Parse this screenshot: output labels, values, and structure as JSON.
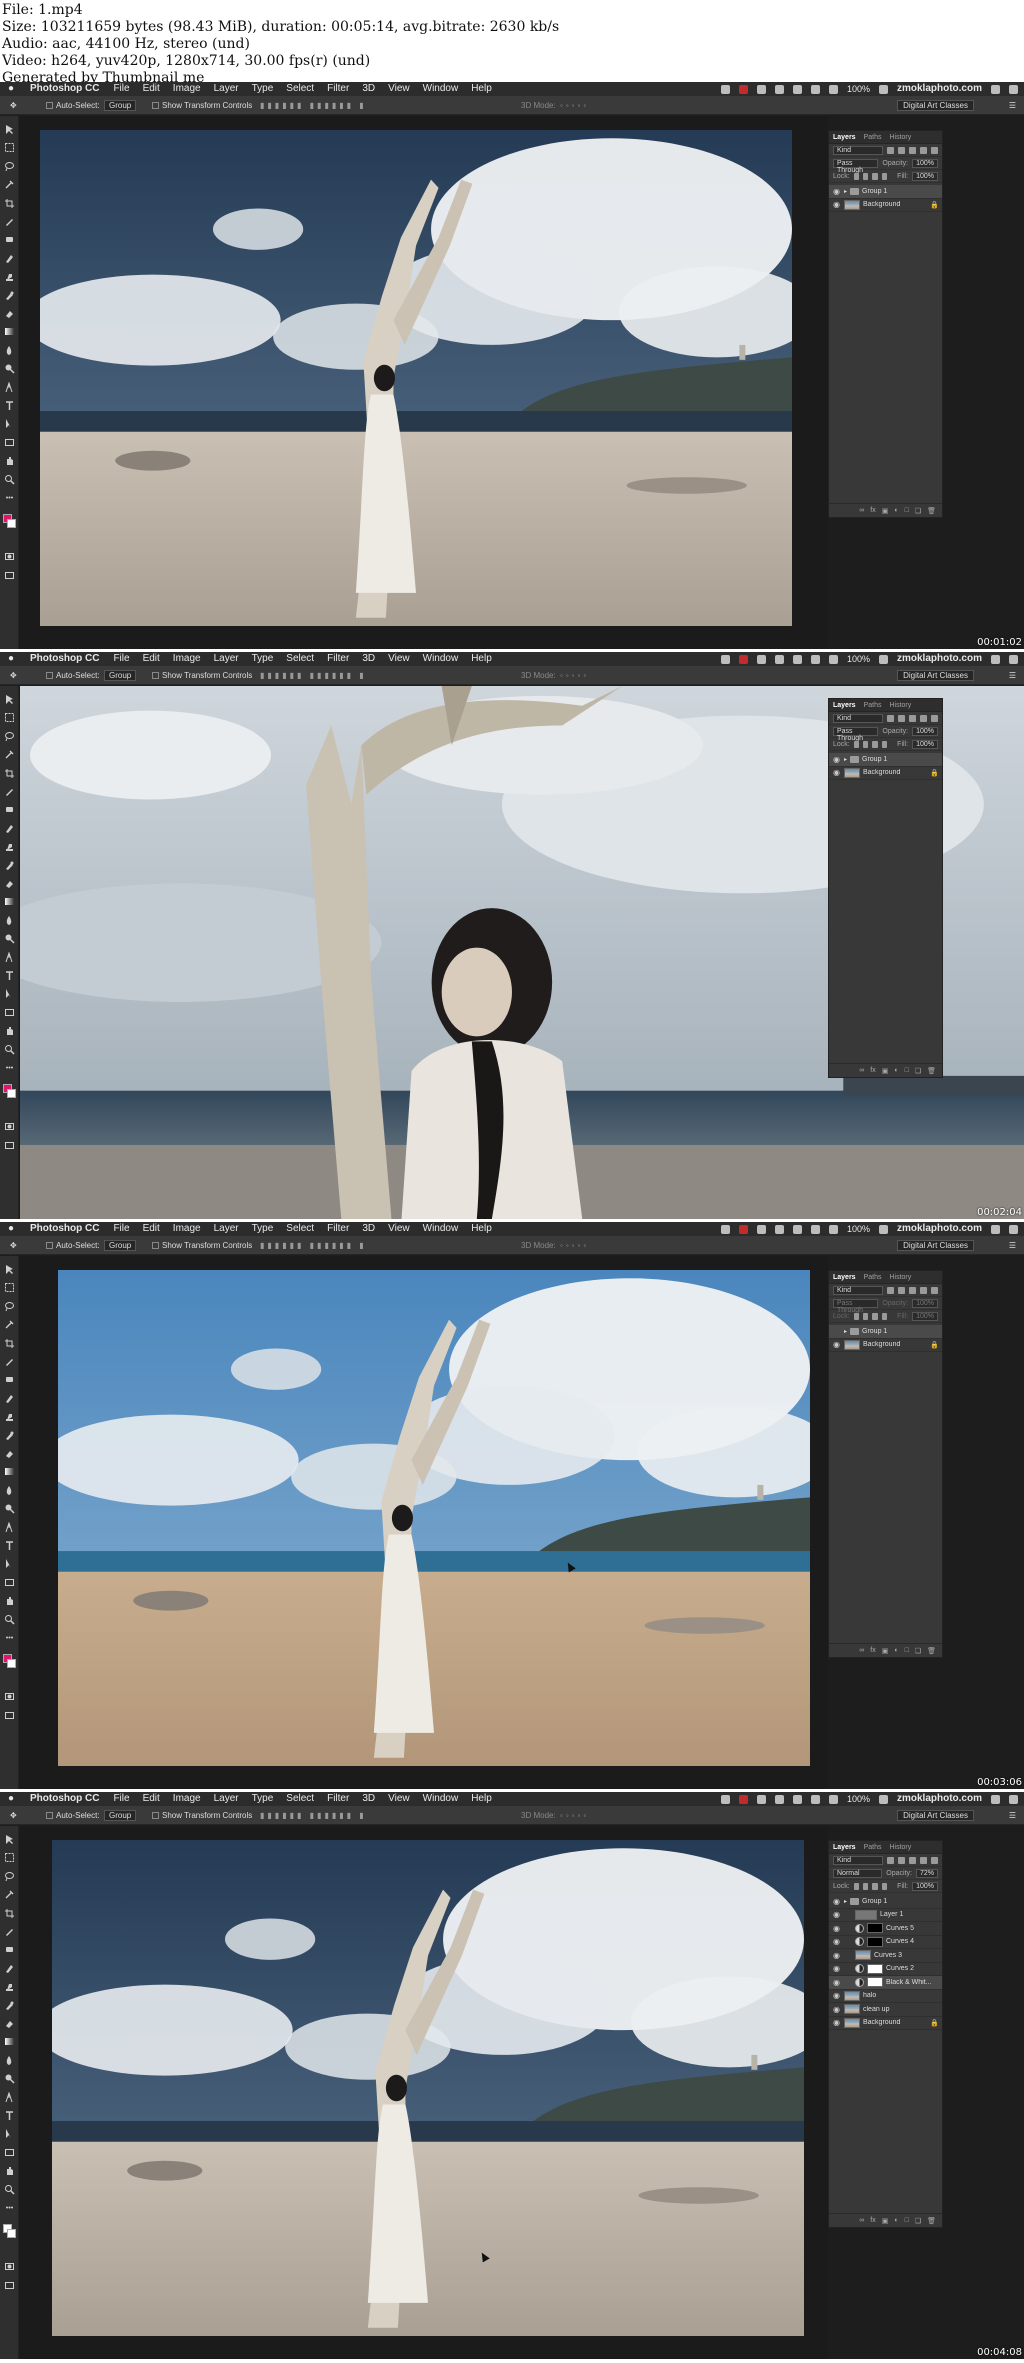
{
  "header": {
    "lines": [
      "File: 1.mp4",
      "Size: 103211659 bytes (98.43 MiB), duration: 00:05:14, avg.bitrate: 2630 kb/s",
      "Audio: aac, 44100 Hz, stereo (und)",
      "Video: h264, yuv420p, 1280x714, 30.00 fps(r) (und)",
      "Generated by Thumbnail me"
    ]
  },
  "menubar": {
    "app_name": "Photoshop CC",
    "items": [
      "File",
      "Edit",
      "Image",
      "Layer",
      "Type",
      "Select",
      "Filter",
      "3D",
      "View",
      "Window",
      "Help"
    ],
    "battery": "100%",
    "site": "zmoklaphoto.com"
  },
  "optionsbar": {
    "auto_select_label": "Auto-Select:",
    "auto_select_value": "Group",
    "transform_label": "Show Transform Controls",
    "mode_3d": "3D Mode:",
    "workspace": "Digital Art Classes"
  },
  "panel": {
    "tabs": [
      "Layers",
      "Paths",
      "History"
    ],
    "kind_label": "Kind",
    "lock_label": "Lock:",
    "fill_label": "Fill:",
    "opacity_label": "Opacity:"
  },
  "frames": [
    {
      "timestamp": "00:01:02",
      "blend": "Pass Through",
      "opacity": "100%",
      "fill": "100%",
      "dimmed": false,
      "layers": [
        {
          "name": "Group 1",
          "type": "folder",
          "visible": true,
          "selected": true,
          "indent": 0
        },
        {
          "name": "Background",
          "type": "img",
          "visible": true,
          "selected": false,
          "indent": 0,
          "locked": true
        }
      ]
    },
    {
      "timestamp": "00:02:04",
      "blend": "Pass Through",
      "opacity": "100%",
      "fill": "100%",
      "dimmed": false,
      "layers": [
        {
          "name": "Group 1",
          "type": "folder",
          "visible": true,
          "selected": true,
          "indent": 0
        },
        {
          "name": "Background",
          "type": "img",
          "visible": true,
          "selected": false,
          "indent": 0,
          "locked": true
        }
      ]
    },
    {
      "timestamp": "00:03:06",
      "blend": "Pass Through",
      "opacity": "100%",
      "fill": "100%",
      "dimmed": true,
      "layers": [
        {
          "name": "Group 1",
          "type": "folder",
          "visible": false,
          "selected": true,
          "indent": 0
        },
        {
          "name": "Background",
          "type": "img",
          "visible": true,
          "selected": false,
          "indent": 0,
          "locked": true
        }
      ]
    },
    {
      "timestamp": "00:04:08",
      "blend": "Normal",
      "opacity": "72%",
      "fill": "100%",
      "dimmed": false,
      "layers": [
        {
          "name": "Group 1",
          "type": "folder",
          "visible": true,
          "selected": false,
          "indent": 0
        },
        {
          "name": "Layer 1",
          "type": "layergrey",
          "visible": true,
          "selected": false,
          "indent": 1
        },
        {
          "name": "Curves 5",
          "type": "black",
          "visible": true,
          "selected": false,
          "indent": 1
        },
        {
          "name": "Curves 4",
          "type": "black",
          "visible": true,
          "selected": false,
          "indent": 1
        },
        {
          "name": "Curves 3",
          "type": "img",
          "visible": true,
          "selected": false,
          "indent": 1
        },
        {
          "name": "Curves 2",
          "type": "white",
          "visible": true,
          "selected": false,
          "indent": 1
        },
        {
          "name": "Black & Whit...",
          "type": "white",
          "visible": true,
          "selected": true,
          "indent": 1
        },
        {
          "name": "halo",
          "type": "img",
          "visible": true,
          "selected": false,
          "indent": 0
        },
        {
          "name": "clean up",
          "type": "img",
          "visible": true,
          "selected": false,
          "indent": 0
        },
        {
          "name": "Background",
          "type": "img",
          "visible": true,
          "selected": false,
          "indent": 0,
          "locked": true
        }
      ]
    }
  ],
  "colors": {
    "foreground_frame1": "#e0156b",
    "foreground_frame4": "#ffffff",
    "sky_blue": "#4f7fa8",
    "sand": "#c7b9a6"
  }
}
